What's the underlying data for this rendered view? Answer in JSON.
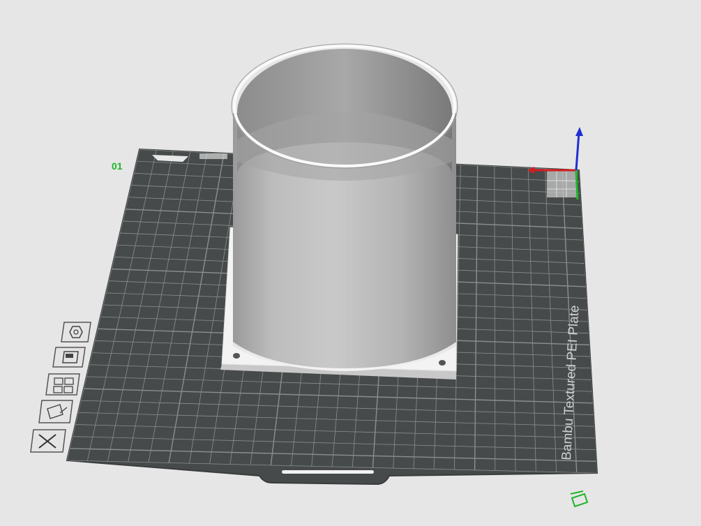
{
  "scene": {
    "background": "#e6e6e6",
    "plate_number": "01",
    "plate_index_label": "01",
    "plate_caption": "Bambu Textured PEI Plate",
    "plate_color": "#474a4b",
    "grid_color": "#8a8f8f",
    "model_color": "#b6b6b6",
    "base_color": "#f3f3f3"
  },
  "axes": {
    "x_color": "#d21f1f",
    "y_color": "#1fb52a",
    "z_color": "#1f2fd2"
  },
  "plate_tools": [
    {
      "name": "auto-orient-icon"
    },
    {
      "name": "plate-settings-icon"
    },
    {
      "name": "arrange-icon"
    },
    {
      "name": "lock-plate-icon"
    },
    {
      "name": "delete-plate-icon"
    }
  ]
}
